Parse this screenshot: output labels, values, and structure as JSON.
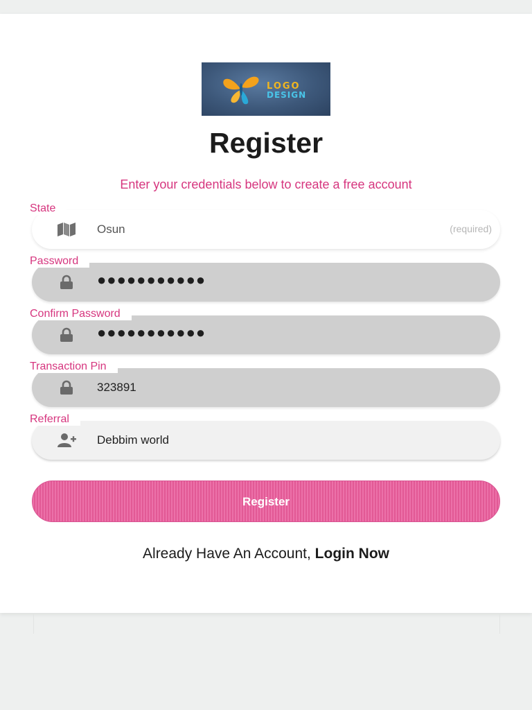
{
  "logo": {
    "line1": "LOGO",
    "line2": "DESIGN"
  },
  "page": {
    "title": "Register",
    "subtitle": "Enter your credentials below to create a free account"
  },
  "fields": {
    "state": {
      "label": "State",
      "value": "Osun",
      "hint": "(required)",
      "icon": "map-icon"
    },
    "password": {
      "label": "Password",
      "value": "●●●●●●●●●●●",
      "icon": "lock-icon"
    },
    "confirm_password": {
      "label": "Confirm Password",
      "value": "●●●●●●●●●●●",
      "icon": "lock-icon"
    },
    "transaction_pin": {
      "label": "Transaction Pin",
      "value": "323891",
      "icon": "lock-icon"
    },
    "referral": {
      "label": "Referral",
      "value": "Debbim world",
      "icon": "user-plus-icon"
    }
  },
  "actions": {
    "register_label": "Register",
    "login_prompt": "Already Have An Account,",
    "login_link": "Login Now"
  },
  "colors": {
    "accent": "#d6357e",
    "button": "#e25995",
    "field_gray": "#cfcfcf"
  }
}
